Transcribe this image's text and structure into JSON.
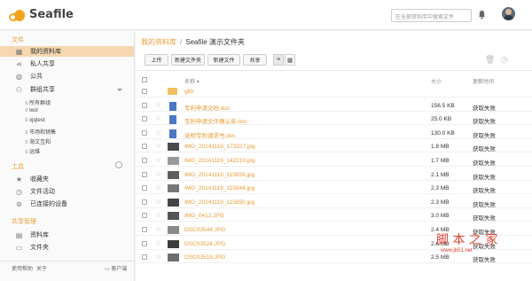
{
  "app": {
    "name": "Seafile"
  },
  "header": {
    "search_placeholder": "在全部资料库中搜索文件"
  },
  "sidebar": {
    "files_title": "文件",
    "files_items": [
      {
        "label": "我的资料库",
        "icon": "grid-icon"
      },
      {
        "label": "私人共享",
        "icon": "share-icon"
      },
      {
        "label": "公共",
        "icon": "globe-icon"
      },
      {
        "label": "群组共享",
        "icon": "group-icon"
      }
    ],
    "group_items": [
      "所有群组",
      "test",
      "xjqtest",
      "市场和销售",
      "海文互和",
      "运维"
    ],
    "tools_title": "工具",
    "tools_items": [
      {
        "label": "收藏夹",
        "icon": "star-icon"
      },
      {
        "label": "文件活动",
        "icon": "clock-icon"
      },
      {
        "label": "已连接的设备",
        "icon": "link-icon"
      }
    ],
    "admin_title": "共享管理",
    "admin_items": [
      {
        "label": "资料库",
        "icon": "library-icon"
      },
      {
        "label": "文件夹",
        "icon": "folder-icon"
      }
    ],
    "footer": {
      "help": "使用帮助",
      "about": "关于",
      "client": "客户端"
    }
  },
  "breadcrumb": {
    "root": "我的资料库",
    "separator": "/",
    "current": "Seafile 演示文件夹"
  },
  "toolbar": {
    "upload": "上传",
    "new_folder": "新建文件夹",
    "new_file": "新建文件",
    "share": "共享"
  },
  "table": {
    "headers": {
      "name": "名称 ▾",
      "size": "大小",
      "modified": "更新时间"
    },
    "rows": [
      {
        "name": "glib",
        "size": "",
        "modified": "",
        "type": "folder"
      },
      {
        "name": "专利申请文档.doc",
        "size": "156.5 KB",
        "modified": "获取失败",
        "type": "doc"
      },
      {
        "name": "专利申请文件确认单.doc",
        "size": "25.0 KB",
        "modified": "获取失败",
        "type": "doc"
      },
      {
        "name": "说明专利请求书.doc",
        "size": "130.0 KB",
        "modified": "获取失败",
        "type": "doc"
      },
      {
        "name": "IMG_20141119_173327.jpg",
        "size": "1.8 MB",
        "modified": "获取失败",
        "type": "img"
      },
      {
        "name": "IMG_20141119_142210.jpg",
        "size": "1.7 MB",
        "modified": "获取失败",
        "type": "img"
      },
      {
        "name": "IMG_20141119_115859.jpg",
        "size": "2.1 MB",
        "modified": "获取失败",
        "type": "img"
      },
      {
        "name": "IMG_20141119_115844.jpg",
        "size": "2.3 MB",
        "modified": "获取失败",
        "type": "img"
      },
      {
        "name": "IMG_20141119_115850.jpg",
        "size": "2.3 MB",
        "modified": "获取失败",
        "type": "img"
      },
      {
        "name": "IMG_0412.JPG",
        "size": "3.0 MB",
        "modified": "获取失败",
        "type": "img"
      },
      {
        "name": "DSC03544.JPG",
        "size": "2.4 MB",
        "modified": "获取失败",
        "type": "img"
      },
      {
        "name": "DSC03524.JPG",
        "size": "2.6 MB",
        "modified": "获取失败",
        "type": "img"
      },
      {
        "name": "DSC03518.JPG",
        "size": "2.5 MB",
        "modified": "获取失败",
        "type": "img"
      }
    ]
  },
  "watermark": {
    "title": "脚 本 之 家",
    "url": "www.jb51.net"
  },
  "colors": {
    "accent": "#e79d38",
    "active_bg": "#f5d7b0"
  }
}
